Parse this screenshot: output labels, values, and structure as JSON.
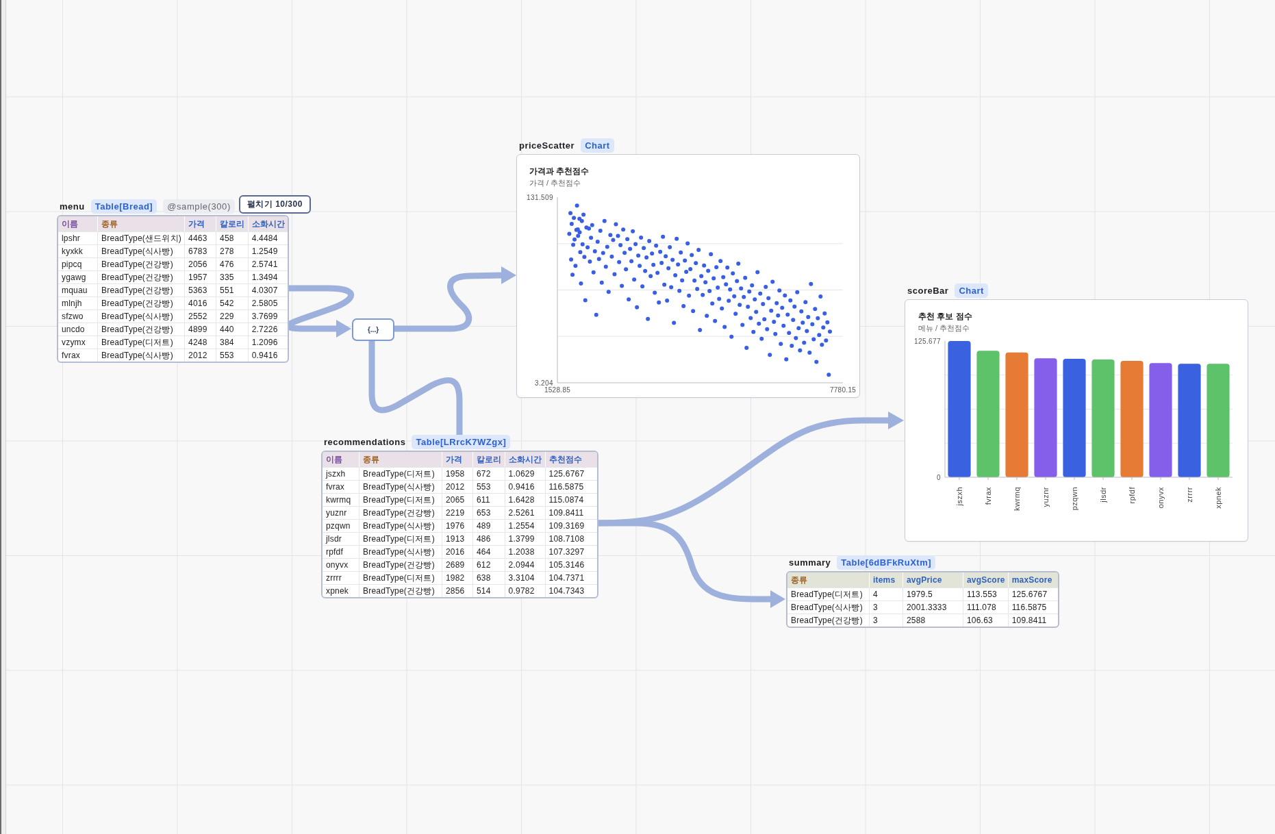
{
  "menu": {
    "name": "menu",
    "type_badge": "Table[Bread]",
    "sample_badge": "@sample(300)",
    "expand_button": "펼치기 10/300",
    "table": {
      "columns": [
        {
          "label": "이름",
          "kind": "name"
        },
        {
          "label": "종류",
          "kind": "category"
        },
        {
          "label": "가격",
          "kind": "number"
        },
        {
          "label": "칼로리",
          "kind": "number"
        },
        {
          "label": "소화시간",
          "kind": "number"
        }
      ],
      "rows": [
        [
          "lpshr",
          "BreadType(샌드위치)",
          "4463",
          "458",
          "4.4484"
        ],
        [
          "kyxkk",
          "BreadType(식사빵)",
          "6783",
          "278",
          "1.2549"
        ],
        [
          "pipcq",
          "BreadType(건강빵)",
          "2056",
          "476",
          "2.5741"
        ],
        [
          "ygawg",
          "BreadType(건강빵)",
          "1957",
          "335",
          "1.3494"
        ],
        [
          "mquau",
          "BreadType(건강빵)",
          "5363",
          "551",
          "4.0307"
        ],
        [
          "mlnjh",
          "BreadType(건강빵)",
          "4016",
          "542",
          "2.5805"
        ],
        [
          "sfzwo",
          "BreadType(식사빵)",
          "2552",
          "229",
          "3.7699"
        ],
        [
          "uncdo",
          "BreadType(건강빵)",
          "4899",
          "440",
          "2.7226"
        ],
        [
          "vzymx",
          "BreadType(디저트)",
          "4248",
          "384",
          "1.2096"
        ],
        [
          "fvrax",
          "BreadType(식사빵)",
          "2012",
          "553",
          "0.9416"
        ]
      ]
    }
  },
  "transform_node": {
    "label": "{...}"
  },
  "price_scatter": {
    "name": "priceScatter",
    "type_badge": "Chart",
    "subtitle": "가격 / 추천점수",
    "chart_data": {
      "type": "scatter",
      "title": "가격과 추천점수",
      "x": [
        1790,
        1815,
        1830,
        1842,
        1860,
        1875,
        1890,
        1905,
        1925,
        1945,
        1958,
        1976,
        1982,
        2012,
        2016,
        2030,
        2045,
        2065,
        2080,
        2100,
        2120,
        2140,
        2165,
        2190,
        2219,
        2240,
        2265,
        2290,
        2320,
        2350,
        2380,
        2410,
        2440,
        2470,
        2500,
        2530,
        2560,
        2590,
        2620,
        2650,
        2689,
        2720,
        2750,
        2780,
        2810,
        2856,
        2880,
        2910,
        2940,
        2970,
        3000,
        3030,
        3060,
        3090,
        3120,
        3150,
        3180,
        3210,
        3240,
        3270,
        3300,
        3330,
        3360,
        3390,
        3420,
        3450,
        3480,
        3510,
        3540,
        3570,
        3600,
        3630,
        3660,
        3690,
        3720,
        3750,
        3780,
        3810,
        3840,
        3870,
        3900,
        3930,
        3960,
        3990,
        4020,
        4050,
        4080,
        4110,
        4140,
        4170,
        4200,
        4230,
        4260,
        4290,
        4320,
        4350,
        4380,
        4410,
        4440,
        4470,
        4500,
        4530,
        4560,
        4590,
        4620,
        4650,
        4680,
        4710,
        4740,
        4770,
        4800,
        4830,
        4860,
        4890,
        4920,
        4950,
        4980,
        5010,
        5040,
        5070,
        5100,
        5130,
        5160,
        5190,
        5220,
        5250,
        5280,
        5310,
        5340,
        5370,
        5400,
        5430,
        5460,
        5490,
        5520,
        5550,
        5580,
        5610,
        5640,
        5670,
        5700,
        5730,
        5760,
        5790,
        5820,
        5850,
        5880,
        5910,
        5940,
        5970,
        6000,
        6030,
        6060,
        6090,
        6120,
        6150,
        6180,
        6210,
        6240,
        6270,
        6300,
        6330,
        6360,
        6390,
        6420,
        6450,
        6480,
        6510,
        6540,
        6570,
        6600,
        6630,
        6660,
        6690,
        6720,
        6750,
        6780,
        6810,
        6840,
        6870,
        6900,
        6930,
        6960,
        6990,
        7020,
        7050,
        7080,
        7110,
        7140,
        7170,
        7200,
        7230,
        7260,
        7290,
        7320,
        7350,
        7380,
        7410,
        7440,
        7470,
        7495
      ],
      "series": [
        {
          "color": "#3a5ee3",
          "values": [
            106.2,
            120.5,
            88.4,
            113.0,
            77.9,
            98.6,
            117.2,
            102.3,
            84.1,
            108.9,
            125.7,
            109.3,
            104.7,
            116.6,
            107.3,
            93.5,
            71.8,
            115.1,
            99.0,
            119.4,
            90.2,
            60.3,
            110.5,
            96.8,
            109.8,
            87.0,
            103.4,
            112.2,
            79.6,
            94.1,
            50.2,
            100.7,
            88.8,
            108.3,
            72.4,
            92.9,
            115.0,
            83.5,
            97.2,
            66.1,
            105.3,
            90.4,
            101.9,
            78.3,
            112.8,
            104.7,
            86.6,
            98.4,
            70.2,
            109.1,
            93.0,
            81.7,
            102.5,
            60.9,
            95.8,
            87.3,
            108.0,
            74.6,
            99.1,
            55.4,
            91.2,
            84.0,
            103.6,
            69.8,
            96.3,
            80.5,
            89.9,
            47.3,
            101.2,
            76.9,
            92.6,
            84.8,
            65.5,
            98.0,
            79.2,
            58.7,
            93.8,
            86.1,
            104.2,
            71.0,
            90.7,
            60.0,
            82.4,
            96.9,
            69.3,
            88.2,
            44.6,
            77.5,
            102.7,
            85.0,
            66.8,
            93.3,
            74.0,
            56.2,
            87.7,
            79.9,
            99.5,
            63.4,
            81.8,
            91.5,
            52.8,
            73.9,
            85.9,
            68.1,
            95.0,
            39.7,
            77.0,
            63.9,
            84.3,
            72.7,
            49.5,
            80.6,
            66.6,
            92.1,
            58.0,
            75.4,
            45.9,
            83.1,
            69.0,
            61.2,
            87.4,
            54.6,
            76.2,
            41.8,
            71.3,
            82.9,
            59.9,
            67.7,
            35.0,
            78.8,
            63.0,
            50.9,
            73.5,
            85.6,
            57.1,
            68.4,
            43.2,
            62.5,
            75.8,
            27.3,
            55.7,
            66.3,
            48.0,
            70.6,
            38.4,
            60.8,
            52.2,
            79.7,
            44.0,
            64.9,
            33.6,
            57.6,
            47.1,
            69.5,
            40.2,
            61.7,
            22.5,
            53.0,
            73.0,
            45.4,
            36.9,
            58.3,
            49.7,
            67.0,
            30.1,
            55.0,
            42.6,
            63.6,
            19.4,
            50.3,
            37.7,
            60.1,
            28.8,
            46.7,
            55.9,
            34.1,
            65.8,
            41.0,
            25.6,
            52.6,
            44.8,
            30.9,
            58.9,
            39.0,
            48.6,
            24.0,
            71.5,
            43.7,
            33.3,
            54.2,
            17.6,
            47.8,
            36.2,
            62.8,
            29.5,
            41.4,
            51.1,
            32.4,
            45.0,
            8.8,
            38.6
          ]
        }
      ],
      "xlim": [
        1528.85,
        7780.15
      ],
      "ylim": [
        3.204,
        131.509
      ],
      "xticks": [
        1528.85,
        7780.15
      ],
      "yticks": [
        3.204,
        131.509
      ]
    }
  },
  "score_bar": {
    "name": "scoreBar",
    "type_badge": "Chart",
    "subtitle": "메뉴 / 추천점수",
    "chart_data": {
      "type": "bar",
      "title": "추천 후보 점수",
      "categories": [
        "jszxh",
        "fvrax",
        "kwrmq",
        "yuznr",
        "pzqwn",
        "jlsdr",
        "rpfdf",
        "onyvx",
        "zrrrr",
        "xpnek"
      ],
      "series": [
        {
          "values": [
            125.677,
            116.6,
            115.1,
            109.8,
            109.3,
            108.7,
            107.3,
            105.3,
            104.7,
            104.7
          ]
        }
      ],
      "ylim": [
        0,
        125.677
      ],
      "yticks": [
        0,
        125.677
      ]
    }
  },
  "recommendations": {
    "name": "recommendations",
    "type_badge": "Table[LRrcK7WZgx]",
    "table": {
      "columns": [
        {
          "label": "이름",
          "kind": "name"
        },
        {
          "label": "종류",
          "kind": "category"
        },
        {
          "label": "가격",
          "kind": "number"
        },
        {
          "label": "칼로리",
          "kind": "number"
        },
        {
          "label": "소화시간",
          "kind": "number"
        },
        {
          "label": "추천점수",
          "kind": "number"
        }
      ],
      "rows": [
        [
          "jszxh",
          "BreadType(디저트)",
          "1958",
          "672",
          "1.0629",
          "125.6767"
        ],
        [
          "fvrax",
          "BreadType(식사빵)",
          "2012",
          "553",
          "0.9416",
          "116.5875"
        ],
        [
          "kwrmq",
          "BreadType(디저트)",
          "2065",
          "611",
          "1.6428",
          "115.0874"
        ],
        [
          "yuznr",
          "BreadType(건강빵)",
          "2219",
          "653",
          "2.5261",
          "109.8411"
        ],
        [
          "pzqwn",
          "BreadType(식사빵)",
          "1976",
          "489",
          "1.2554",
          "109.3169"
        ],
        [
          "jlsdr",
          "BreadType(디저트)",
          "1913",
          "486",
          "1.3799",
          "108.7108"
        ],
        [
          "rpfdf",
          "BreadType(식사빵)",
          "2016",
          "464",
          "1.2038",
          "107.3297"
        ],
        [
          "onyvx",
          "BreadType(건강빵)",
          "2689",
          "612",
          "2.0944",
          "105.3146"
        ],
        [
          "zrrrr",
          "BreadType(디저트)",
          "1982",
          "638",
          "3.3104",
          "104.7371"
        ],
        [
          "xpnek",
          "BreadType(건강빵)",
          "2856",
          "514",
          "0.9782",
          "104.7343"
        ]
      ]
    }
  },
  "summary": {
    "name": "summary",
    "type_badge": "Table[6dBFkRuXtm]",
    "table": {
      "columns": [
        {
          "label": "종류",
          "kind": "category"
        },
        {
          "label": "items",
          "kind": "number"
        },
        {
          "label": "avgPrice",
          "kind": "number"
        },
        {
          "label": "avgScore",
          "kind": "number"
        },
        {
          "label": "maxScore",
          "kind": "number"
        }
      ],
      "rows": [
        [
          "BreadType(디저트)",
          "4",
          "1979.5",
          "113.553",
          "125.6767"
        ],
        [
          "BreadType(식사빵)",
          "3",
          "2001.3333",
          "111.078",
          "116.5875"
        ],
        [
          "BreadType(건강빵)",
          "3",
          "2588",
          "106.63",
          "109.8411"
        ]
      ]
    }
  }
}
